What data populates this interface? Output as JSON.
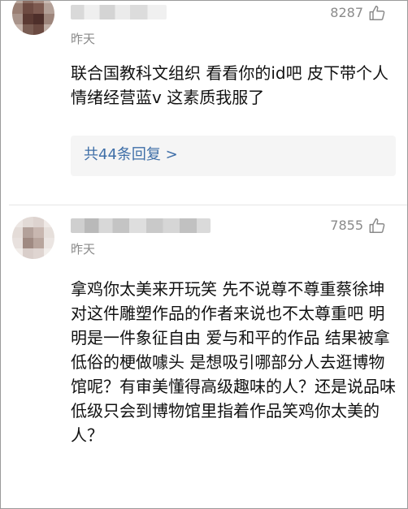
{
  "comments": [
    {
      "time": "昨天",
      "likes": "8287",
      "text": "联合国教科文组织 看看你的id吧 皮下带个人情绪经营蓝v 这素质我服了",
      "replies_label": "共44条回复 >",
      "like_icon": "thumbs-up-outline-icon"
    },
    {
      "time": "昨天",
      "likes": "7855",
      "text": "拿鸡你太美来开玩笑 先不说尊不尊重蔡徐坤 对这件雕塑作品的作者来说也不太尊重吧 明明是一件象征自由 爱与和平的作品 结果被拿低俗的梗做噱头 是想吸引哪部分人去逛博物馆呢？有审美懂得高级趣味的人？还是说品味低级只会到博物馆里指着作品笑鸡你太美的人？",
      "like_icon": "thumbs-up-outline-icon"
    }
  ],
  "colors": {
    "link": "#3f6fa8",
    "meta": "#8a8a8a",
    "text": "#111111",
    "reply_bg": "#f5f5f5"
  }
}
